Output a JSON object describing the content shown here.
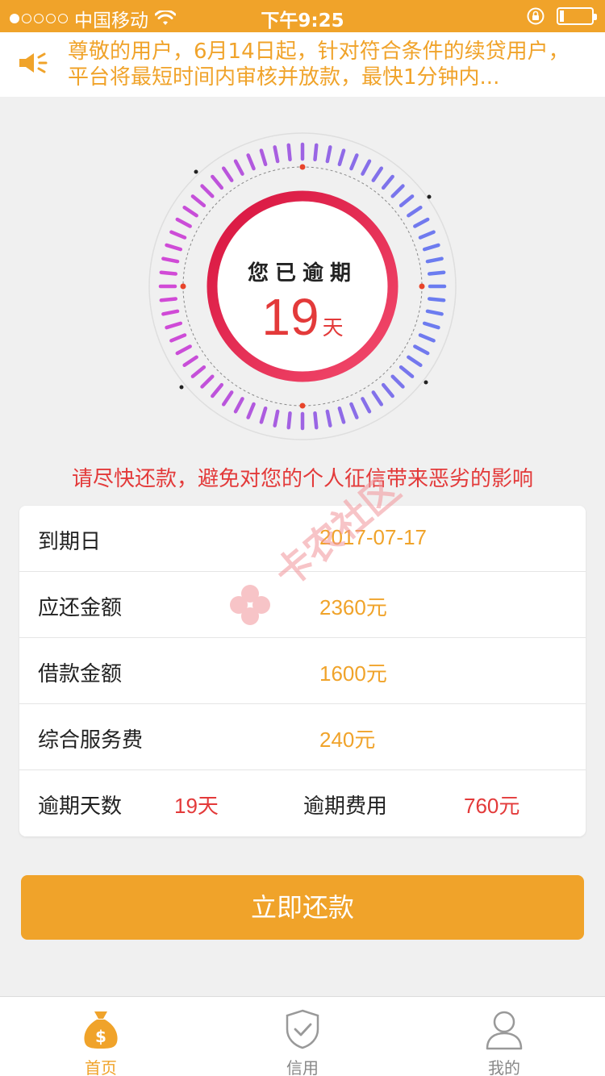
{
  "status_bar": {
    "carrier": "中国移动",
    "time": "下午9:25",
    "signal_level": 1,
    "battery_level": 0.12
  },
  "notice": {
    "icon": "speaker-icon",
    "text": "尊敬的用户，6月14日起，针对符合条件的续贷用户，平台将最短时间内审核并放款，最快1分钟内..."
  },
  "dial": {
    "title": "您已逾期",
    "days": "19",
    "unit": "天"
  },
  "warning": "请尽快还款，避免对您的个人征信带来恶劣的影响",
  "details": {
    "due_date_label": "到期日",
    "due_date": "2017-07-17",
    "amount_due_label": "应还金额",
    "amount_due": "2360元",
    "loan_amount_label": "借款金额",
    "loan_amount": "1600元",
    "service_fee_label": "综合服务费",
    "service_fee": "240元",
    "overdue_days_label": "逾期天数",
    "overdue_days": "19天",
    "overdue_fee_label": "逾期费用",
    "overdue_fee": "760元"
  },
  "pay_button": "立即还款",
  "watermark": "卡农社区",
  "tabs": [
    {
      "label": "首页",
      "icon": "money-bag-icon",
      "active": true
    },
    {
      "label": "信用",
      "icon": "shield-check-icon",
      "active": false
    },
    {
      "label": "我的",
      "icon": "user-icon",
      "active": false
    }
  ],
  "colors": {
    "accent": "#f0a32a",
    "alert": "#e33a3a",
    "ring_start": "#e8164e",
    "ticks_from": "#d14ad6",
    "ticks_to": "#6b7cf0"
  }
}
